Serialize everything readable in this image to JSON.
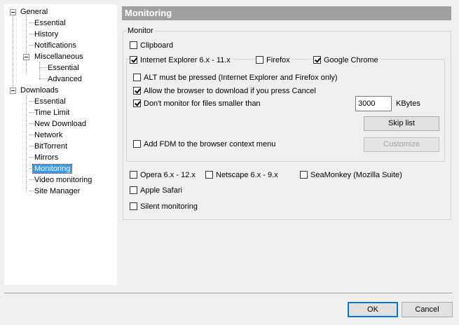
{
  "tree": {
    "items": [
      {
        "label": "General"
      },
      {
        "label": "Essential"
      },
      {
        "label": "History"
      },
      {
        "label": "Notifications"
      },
      {
        "label": "Miscellaneous"
      },
      {
        "label": "Essential"
      },
      {
        "label": "Advanced"
      },
      {
        "label": "Downloads"
      },
      {
        "label": "Essential"
      },
      {
        "label": "Time Limit"
      },
      {
        "label": "New Download"
      },
      {
        "label": "Network"
      },
      {
        "label": "BitTorrent"
      },
      {
        "label": "Mirrors"
      },
      {
        "label": "Monitoring"
      },
      {
        "label": "Video monitoring"
      },
      {
        "label": "Site Manager"
      }
    ],
    "selected": "Monitoring"
  },
  "panel": {
    "title": "Monitoring",
    "group_label": "Monitor",
    "clipboard": {
      "label": "Clipboard",
      "checked": false
    },
    "ie": {
      "label": "Internet Explorer 6.x - 11.x",
      "checked": true
    },
    "firefox": {
      "label": "Firefox",
      "checked": false
    },
    "chrome": {
      "label": "Google Chrome",
      "checked": true
    },
    "alt_pressed": {
      "label": "ALT must be pressed (Internet Explorer and Firefox only)",
      "checked": false
    },
    "allow_browser": {
      "label": "Allow the browser to download if you press Cancel",
      "checked": true
    },
    "dont_monitor": {
      "label": "Don't monitor for files smaller than",
      "checked": true
    },
    "size_value": "3000",
    "size_unit": "KBytes",
    "skip_list": "Skip list",
    "add_context": {
      "label": "Add FDM to the browser context menu",
      "checked": false
    },
    "customize": "Customize",
    "opera": {
      "label": "Opera 6.x - 12.x",
      "checked": false
    },
    "netscape": {
      "label": "Netscape 6.x - 9.x",
      "checked": false
    },
    "seamonkey": {
      "label": "SeaMonkey (Mozilla Suite)",
      "checked": false
    },
    "safari": {
      "label": "Apple Safari",
      "checked": false
    },
    "silent": {
      "label": "Silent monitoring",
      "checked": false
    }
  },
  "footer": {
    "ok": "OK",
    "cancel": "Cancel"
  },
  "colors": {
    "header_bg": "#a0a0a0",
    "selection": "#3399ff",
    "default_button_border": "#0078d7"
  }
}
